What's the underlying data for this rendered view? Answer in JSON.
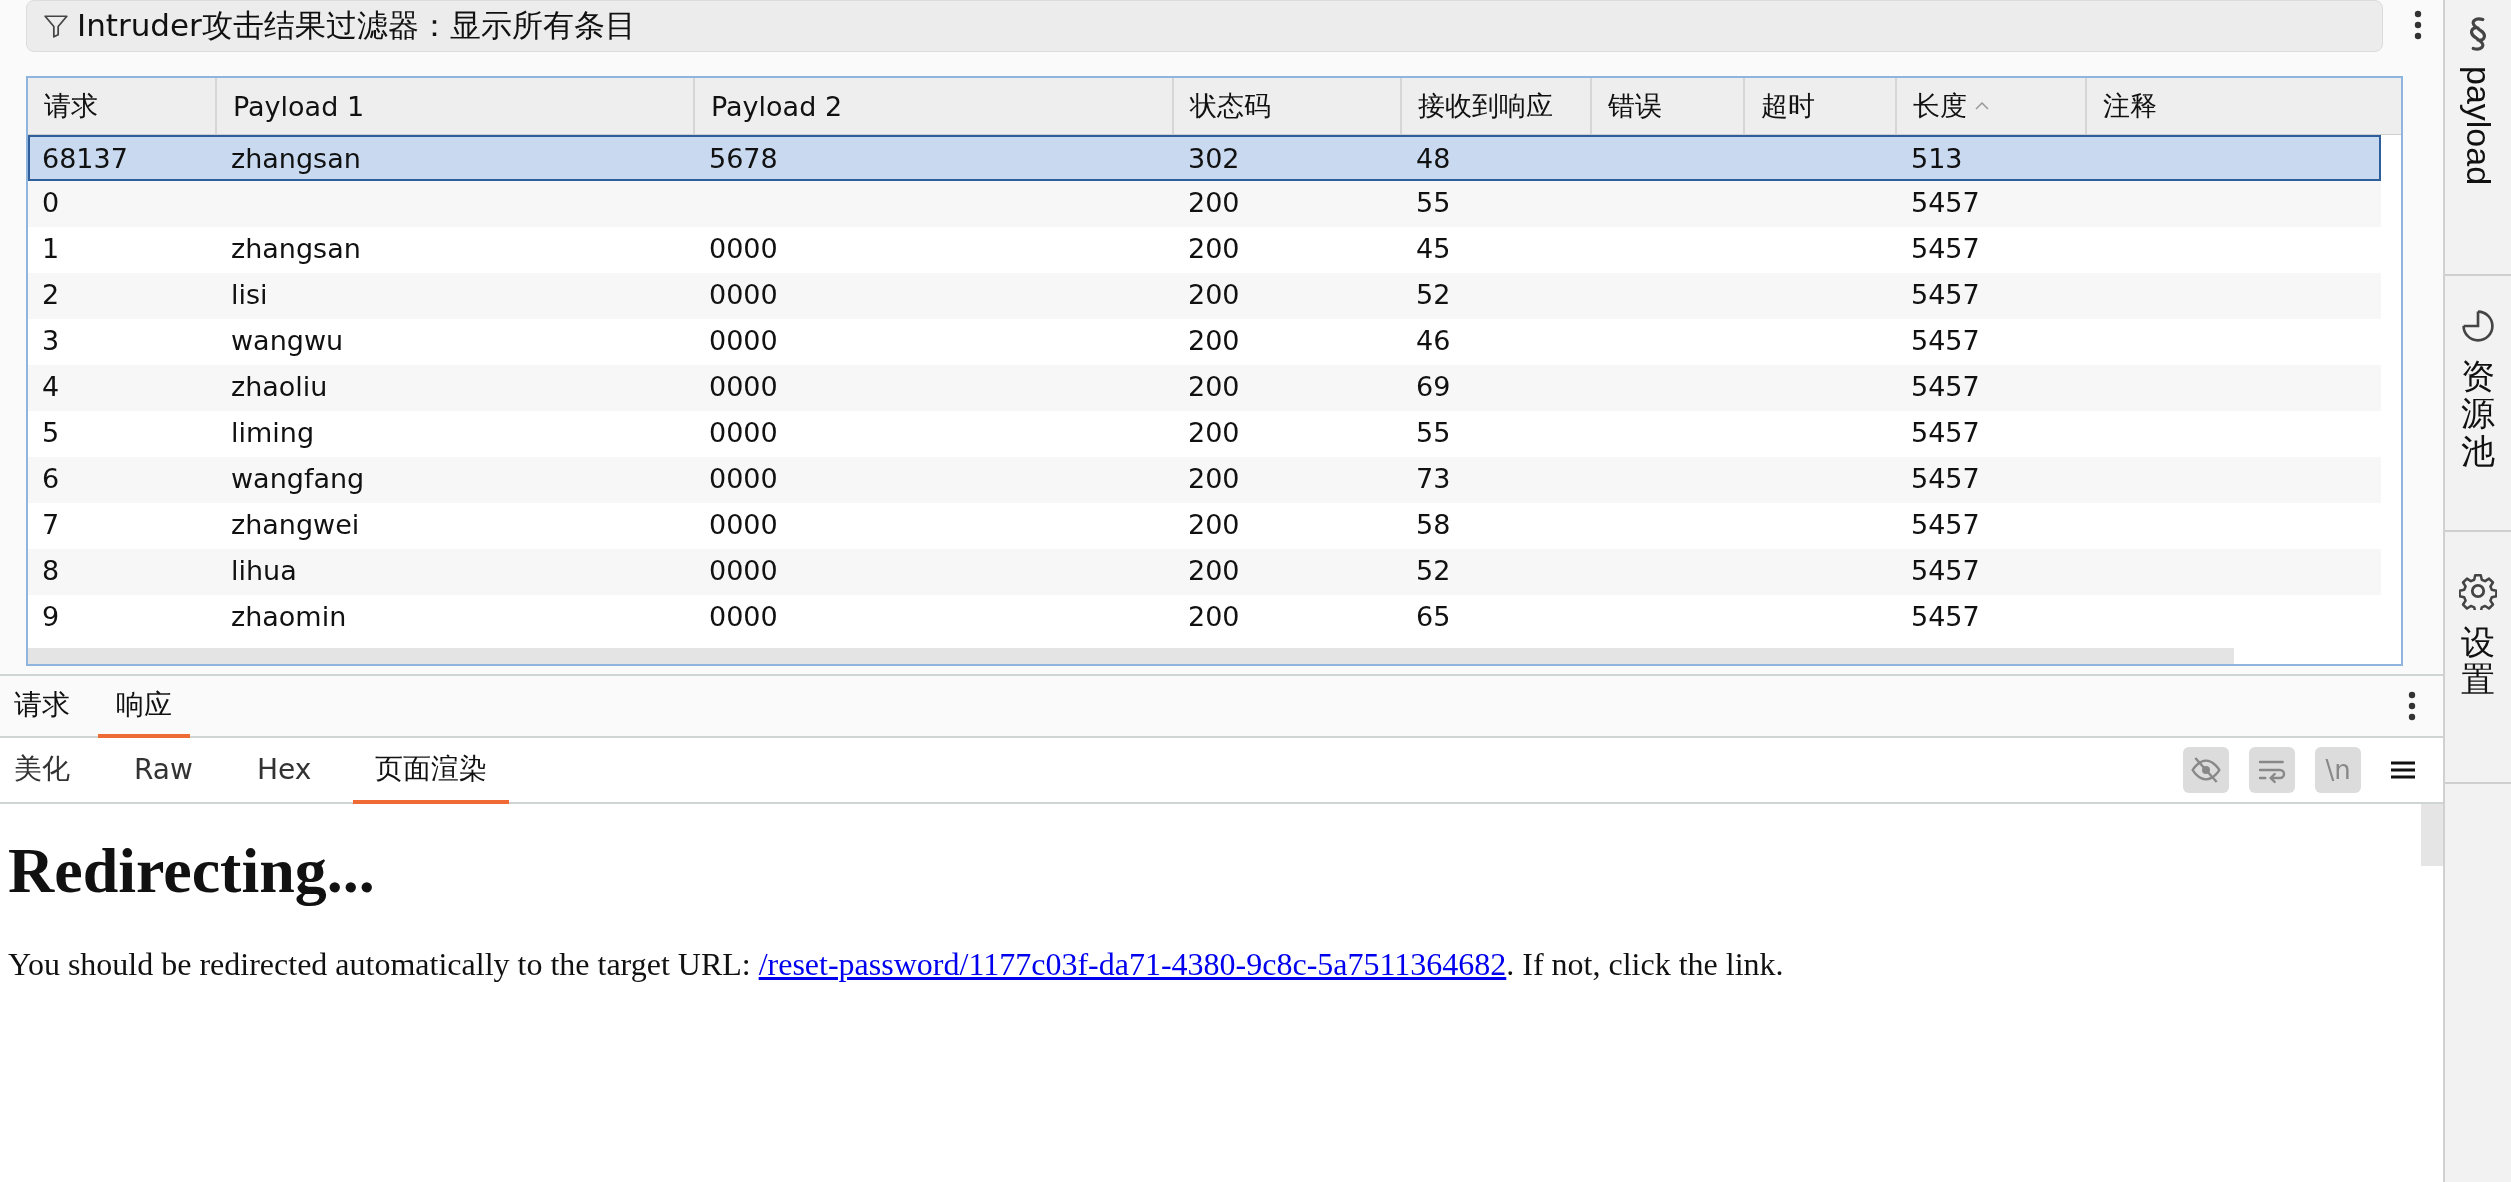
{
  "filter_bar": {
    "label": "Intruder攻击结果过滤器：显示所有条目"
  },
  "results_table": {
    "columns": [
      {
        "label": "请求",
        "sorted": false
      },
      {
        "label": "Payload 1",
        "sorted": false
      },
      {
        "label": "Payload 2",
        "sorted": false
      },
      {
        "label": "状态码",
        "sorted": false
      },
      {
        "label": "接收到响应",
        "sorted": false
      },
      {
        "label": "错误",
        "sorted": false
      },
      {
        "label": "超时",
        "sorted": false
      },
      {
        "label": "长度",
        "sorted": true
      },
      {
        "label": "注释",
        "sorted": false
      }
    ],
    "rows": [
      {
        "selected": true,
        "cells": [
          "68137",
          "zhangsan",
          "5678",
          "302",
          "48",
          "",
          "",
          "513",
          ""
        ]
      },
      {
        "selected": false,
        "cells": [
          "0",
          "",
          "",
          "200",
          "55",
          "",
          "",
          "5457",
          ""
        ]
      },
      {
        "selected": false,
        "cells": [
          "1",
          "zhangsan",
          "0000",
          "200",
          "45",
          "",
          "",
          "5457",
          ""
        ]
      },
      {
        "selected": false,
        "cells": [
          "2",
          "lisi",
          "0000",
          "200",
          "52",
          "",
          "",
          "5457",
          ""
        ]
      },
      {
        "selected": false,
        "cells": [
          "3",
          "wangwu",
          "0000",
          "200",
          "46",
          "",
          "",
          "5457",
          ""
        ]
      },
      {
        "selected": false,
        "cells": [
          "4",
          "zhaoliu",
          "0000",
          "200",
          "69",
          "",
          "",
          "5457",
          ""
        ]
      },
      {
        "selected": false,
        "cells": [
          "5",
          "liming",
          "0000",
          "200",
          "55",
          "",
          "",
          "5457",
          ""
        ]
      },
      {
        "selected": false,
        "cells": [
          "6",
          "wangfang",
          "0000",
          "200",
          "73",
          "",
          "",
          "5457",
          ""
        ]
      },
      {
        "selected": false,
        "cells": [
          "7",
          "zhangwei",
          "0000",
          "200",
          "58",
          "",
          "",
          "5457",
          ""
        ]
      },
      {
        "selected": false,
        "cells": [
          "8",
          "lihua",
          "0000",
          "200",
          "52",
          "",
          "",
          "5457",
          ""
        ]
      },
      {
        "selected": false,
        "cells": [
          "9",
          "zhaomin",
          "0000",
          "200",
          "65",
          "",
          "",
          "5457",
          ""
        ]
      }
    ]
  },
  "message_tabs": [
    {
      "label": "请求",
      "selected": false
    },
    {
      "label": "响应",
      "selected": true
    }
  ],
  "view_tabs": [
    {
      "label": "美化",
      "selected": false
    },
    {
      "label": "Raw",
      "selected": false
    },
    {
      "label": "Hex",
      "selected": false
    },
    {
      "label": "页面渲染",
      "selected": true
    }
  ],
  "toolbar": {
    "newline_label": "\\n"
  },
  "rendered_page": {
    "heading": "Redirecting...",
    "text_before": "You should be redirected automatically to the target URL: ",
    "link": "/reset-password/1177c03f-da71-4380-9c8c-5a7511364682",
    "text_after": ". If not, click the link."
  },
  "sidebar": {
    "items": [
      {
        "label": "payload",
        "kind": "latin"
      },
      {
        "label": "资源池",
        "kind": "cjk"
      },
      {
        "label": "设置",
        "kind": "cjk"
      }
    ]
  }
}
